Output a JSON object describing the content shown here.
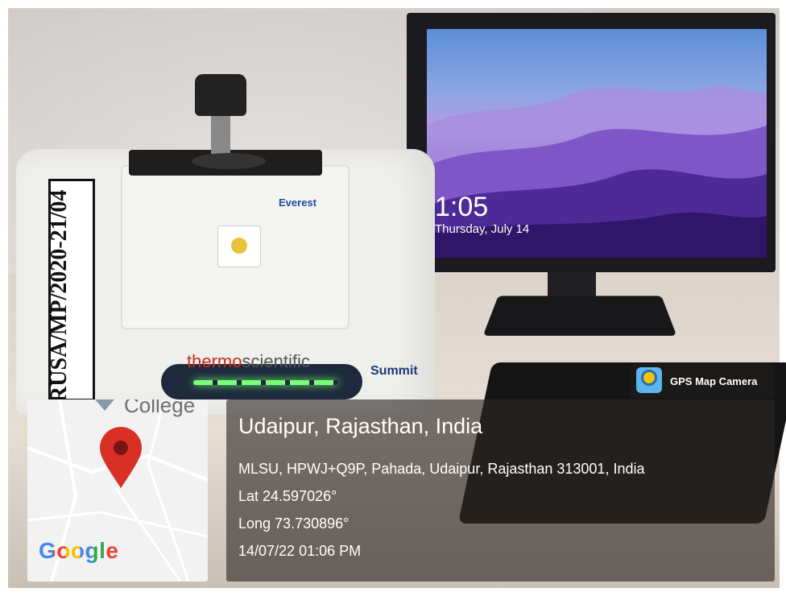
{
  "photo": {
    "monitor": {
      "time": "1:05",
      "date": "Thursday, July 14"
    },
    "instrument": {
      "tape_label": "RUSA/MP/2020-21/04",
      "model": "Everest",
      "brand_primary": "thermo",
      "brand_secondary": "scientific",
      "product": "Summit"
    }
  },
  "overlay": {
    "badge_label": "GPS Map Camera",
    "badge_icon": "gps-map-camera-icon",
    "map": {
      "place_label": "College",
      "logo": "Google",
      "marker_icon": "map-pin-icon",
      "marker_color": "#d93025"
    },
    "location_title": "Udaipur, Rajasthan, India",
    "address": "MLSU, HPWJ+Q9P, Pahada, Udaipur, Rajasthan 313001, India",
    "latitude": "Lat 24.597026°",
    "longitude": "Long 73.730896°",
    "timestamp": "14/07/22 01:06 PM"
  }
}
